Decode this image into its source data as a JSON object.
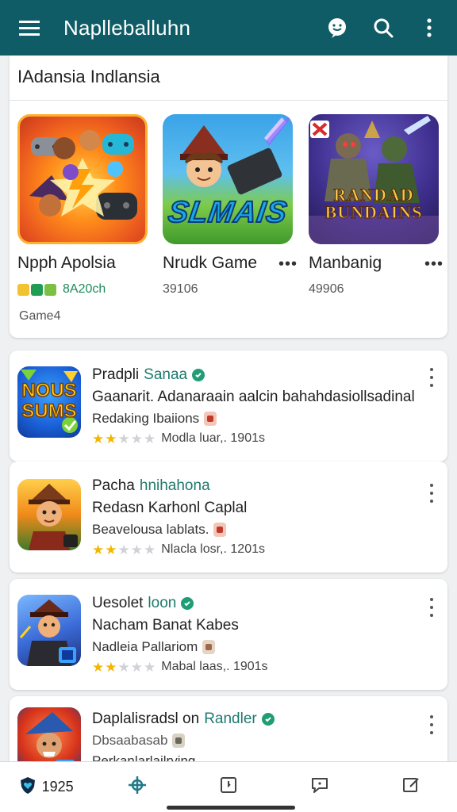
{
  "colors": {
    "appbar": "#0f5c66",
    "accent": "#1f7a6d",
    "star": "#f2b705",
    "star_empty": "#cfd2d6"
  },
  "appbar": {
    "title": "Naplleballuhn",
    "icons": [
      "menu-icon",
      "chat-bubble-icon",
      "search-icon",
      "more-vert-icon"
    ]
  },
  "featured": {
    "section_title": "IAdansia Indlansia",
    "sub_label": "Game4",
    "items": [
      {
        "name": "Npph Apolsia",
        "meta": "8A20ch",
        "art_text": ""
      },
      {
        "name": "Nrudk Game",
        "meta": "39106",
        "art_text": "SLMAIS"
      },
      {
        "name": "Manbanig",
        "meta": "49906",
        "art_text": "RANDAD BUNDAINS"
      }
    ]
  },
  "apps": [
    {
      "line1": "Pradpli",
      "accent": "Sanaa",
      "line2": "Gaanarit. Adanaraain aalcin bahahdasiollsadinal",
      "line3": "Redaking Ibaiions",
      "rating": 2,
      "stats": "Modla luar,. 1901s",
      "art_text": "NOUS SUMS"
    },
    {
      "line1": "Pacha",
      "accent": "hnihahona",
      "line2": "Redasn Karhonl Caplal",
      "line3": "Beavelousa lablats.",
      "rating": 2,
      "stats": "Nlacla losr,. 1201s",
      "art_text": ""
    },
    {
      "line1": "Uesolet",
      "accent": "loon",
      "line2": "Nacham Banat Kabes",
      "line3": "Nadleia Pallariom",
      "rating": 2,
      "stats": "Mabal laas,. 1901s",
      "art_text": ""
    },
    {
      "line1": "Daplalisradsl on",
      "accent": "Randler",
      "line2": "Dbsaabasab",
      "line3": "Perkanlarlailrying",
      "rating": 0,
      "stats": "",
      "art_text": ""
    }
  ],
  "bottomnav": {
    "count": "1925",
    "icons": [
      "shield-heart-icon",
      "crosshair-icon",
      "bookmark-icon",
      "chat-icon",
      "edit-icon"
    ]
  }
}
